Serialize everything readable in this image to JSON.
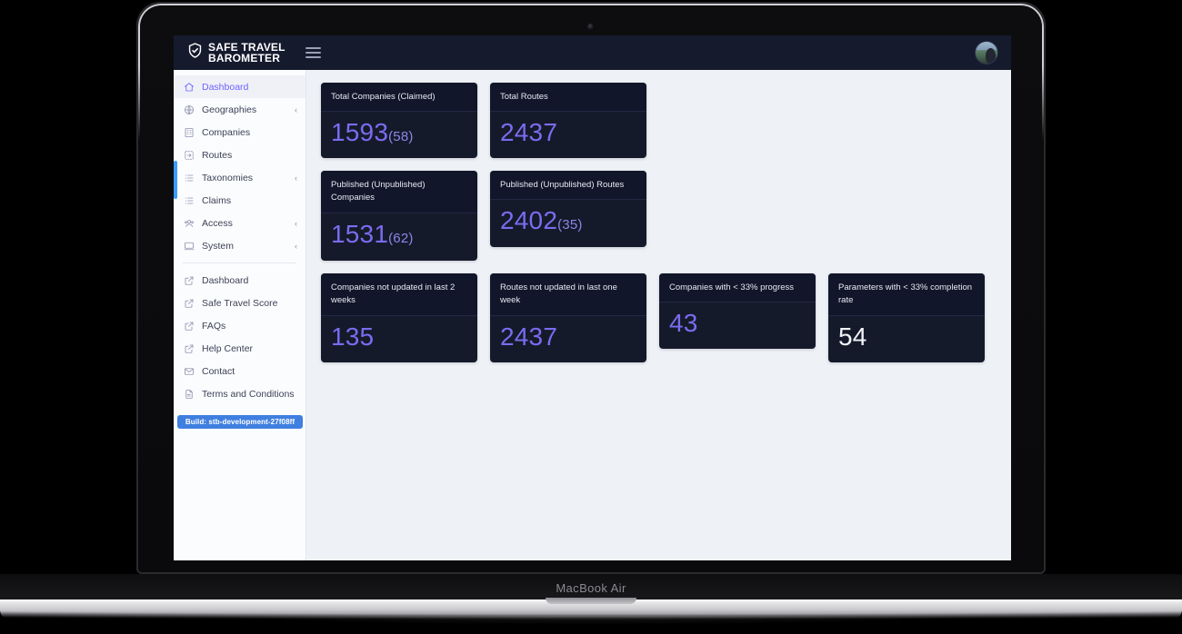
{
  "device": {
    "label": "MacBook Air"
  },
  "navbar": {
    "brand_line1": "SAFE TRAVEL",
    "brand_line2": "BAROMETER",
    "menu_icon": "hamburger-icon",
    "shield_icon": "shield-check-icon",
    "avatar_icon": "user-avatar"
  },
  "sidebar": {
    "build_badge": "Build: stb-development-27f08ff",
    "primary_items": [
      {
        "label": "Dashboard",
        "icon": "home-icon",
        "caret": "",
        "active": true
      },
      {
        "label": "Geographies",
        "icon": "globe-icon",
        "caret": "‹",
        "active": false
      },
      {
        "label": "Companies",
        "icon": "building-icon",
        "caret": "",
        "active": false
      },
      {
        "label": "Routes",
        "icon": "route-icon",
        "caret": "",
        "active": false
      },
      {
        "label": "Taxonomies",
        "icon": "list-icon",
        "caret": "‹",
        "active": false
      },
      {
        "label": "Claims",
        "icon": "list-icon",
        "caret": "",
        "active": false
      },
      {
        "label": "Access",
        "icon": "users-icon",
        "caret": "‹",
        "active": false
      },
      {
        "label": "System",
        "icon": "monitor-icon",
        "caret": "‹",
        "active": false
      }
    ],
    "secondary_items": [
      {
        "label": "Dashboard",
        "icon": "external-link-icon"
      },
      {
        "label": "Safe Travel Score",
        "icon": "external-link-icon"
      },
      {
        "label": "FAQs",
        "icon": "external-link-icon"
      },
      {
        "label": "Help Center",
        "icon": "external-link-icon"
      },
      {
        "label": "Contact",
        "icon": "mail-icon"
      },
      {
        "label": "Terms and Conditions",
        "icon": "document-icon"
      }
    ]
  },
  "cards": [
    {
      "title": "Total Companies (Claimed)",
      "value": "1593",
      "sub": "(58)",
      "white": false,
      "width": 172,
      "head_h": 32,
      "body_h": 62
    },
    {
      "title": "Total Routes",
      "value": "2437",
      "sub": "",
      "white": false,
      "width": 172,
      "head_h": 32,
      "body_h": 62
    },
    {
      "title": "Published (Unpublished) Companies",
      "value": "1531",
      "sub": "(62)",
      "white": false,
      "width": 172,
      "head_h": 47,
      "body_h": 62
    },
    {
      "title": "Published (Unpublished) Routes",
      "value": "2402",
      "sub": "(35)",
      "white": false,
      "width": 172,
      "head_h": 32,
      "body_h": 62
    },
    {
      "title": "Companies not updated in last 2 weeks",
      "value": "135",
      "sub": "",
      "white": false,
      "width": 172,
      "head_h": 47,
      "body_h": 62
    },
    {
      "title": "Routes not updated in last one week",
      "value": "2437",
      "sub": "",
      "white": false,
      "width": 172,
      "head_h": 47,
      "body_h": 62
    },
    {
      "title": "Companies with < 33% progress",
      "value": "43",
      "sub": "",
      "white": false,
      "width": 172,
      "head_h": 32,
      "body_h": 62
    },
    {
      "title": "Parameters with < 33% completion rate",
      "value": "54",
      "sub": "",
      "white": true,
      "width": 172,
      "head_h": 47,
      "body_h": 62
    }
  ],
  "colors": {
    "navbar_bg": "#151a2d",
    "card_bg": "#151a2b",
    "card_head_bg": "#11162a",
    "accent_purple": "#7a6cf0",
    "active_text": "#6c63ff",
    "content_bg": "#eef1f6",
    "badge_blue": "#3f7fe0",
    "scroll_blue": "#3b9bff"
  }
}
